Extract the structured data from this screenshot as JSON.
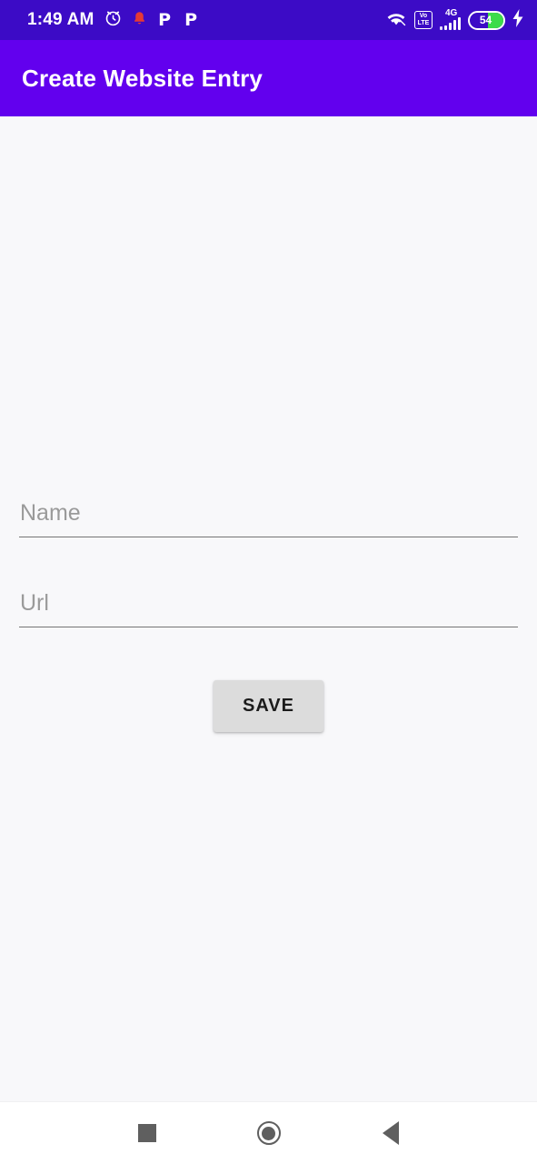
{
  "status_bar": {
    "time": "1:49 AM",
    "icons": [
      "alarm-clock-icon",
      "notification-bell-icon",
      "phonepe-icon",
      "phonepe-icon"
    ],
    "phonepe_glyph": "P",
    "wifi": "wifi-icon",
    "volte_line1": "Vo",
    "volte_line2": "LTE",
    "network_type": "4G",
    "battery_level": "54",
    "charging": true,
    "background_color": "#3c0bc6"
  },
  "app_bar": {
    "title": "Create Website Entry",
    "background_color": "#6200ee",
    "text_color": "#ffffff"
  },
  "form": {
    "fields": [
      {
        "name": "name",
        "placeholder": "Name",
        "value": ""
      },
      {
        "name": "url",
        "placeholder": "Url",
        "value": ""
      }
    ],
    "save_label": "SAVE",
    "save_color": "#dcdcdc"
  },
  "nav_bar": {
    "recents": "recents-square-icon",
    "home": "home-circle-icon",
    "back": "back-triangle-icon"
  }
}
